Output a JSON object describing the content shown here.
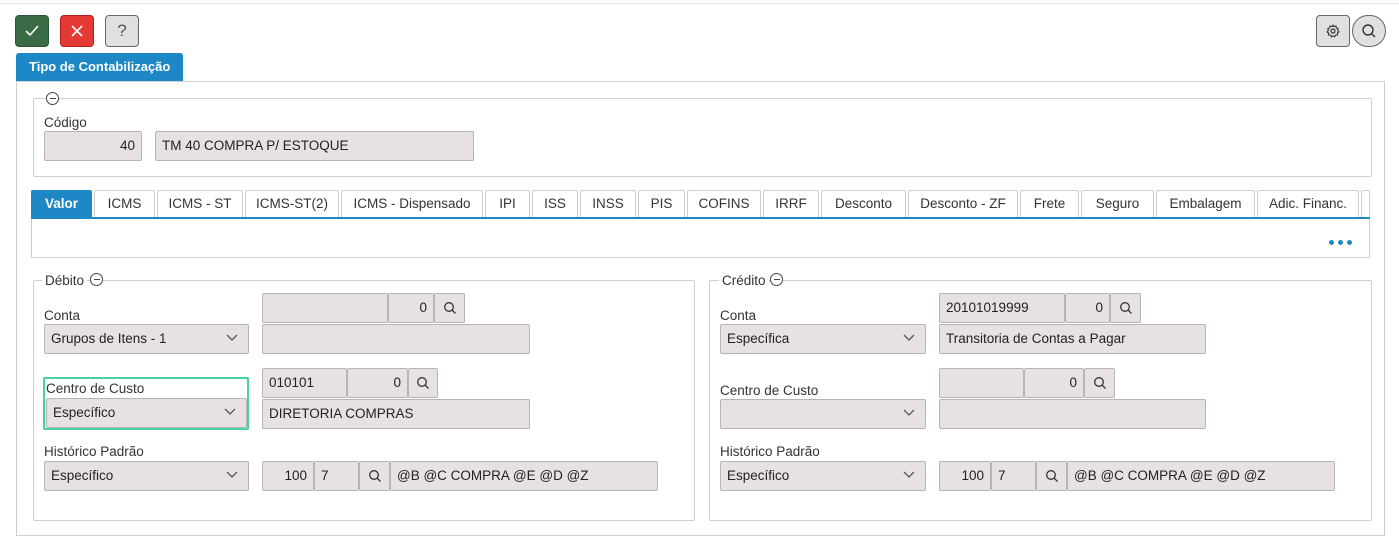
{
  "toolbar": {
    "confirm_icon": "check-icon",
    "cancel_icon": "close-icon",
    "help_label": "?",
    "gear_icon": "gear-icon",
    "search_icon": "search-icon"
  },
  "main_tab": {
    "label": "Tipo de Contabilização"
  },
  "header": {
    "codigo_label": "Código",
    "codigo_value": "40",
    "descricao_value": "TM 40 COMPRA P/ ESTOQUE"
  },
  "tabs": [
    {
      "label": "Valor",
      "active": true
    },
    {
      "label": "ICMS"
    },
    {
      "label": "ICMS - ST"
    },
    {
      "label": "ICMS-ST(2)"
    },
    {
      "label": "ICMS - Dispensado"
    },
    {
      "label": "IPI"
    },
    {
      "label": "ISS"
    },
    {
      "label": "INSS"
    },
    {
      "label": "PIS"
    },
    {
      "label": "COFINS"
    },
    {
      "label": "IRRF"
    },
    {
      "label": "Desconto"
    },
    {
      "label": "Desconto - ZF"
    },
    {
      "label": "Frete"
    },
    {
      "label": "Seguro"
    },
    {
      "label": "Embalagem"
    },
    {
      "label": "Adic. Financ."
    }
  ],
  "debito": {
    "title": "Débito",
    "conta_label": "Conta",
    "conta_code": "",
    "conta_num": "0",
    "conta_select": "Grupos de Itens - 1",
    "conta_desc": "",
    "cc_label": "Centro de Custo",
    "cc_code": "010101",
    "cc_num": "0",
    "cc_select": "Específico",
    "cc_desc": "DIRETORIA COMPRAS",
    "hist_label": "Histórico Padrão",
    "hist_select": "Específico",
    "hist_num1": "100",
    "hist_num2": "7",
    "hist_desc": "@B @C COMPRA @E @D @Z"
  },
  "credito": {
    "title": "Crédito",
    "conta_label": "Conta",
    "conta_code": "20101019999",
    "conta_num": "0",
    "conta_select": "Específica",
    "conta_desc": "Transitoria de Contas a Pagar",
    "cc_label": "Centro de Custo",
    "cc_code": "",
    "cc_num": "0",
    "cc_select": "",
    "cc_desc": "",
    "hist_label": "Histórico Padrão",
    "hist_select": "Específico",
    "hist_num1": "100",
    "hist_num2": "7",
    "hist_desc": "@B @C COMPRA @E @D @Z"
  },
  "colors": {
    "accent": "#1e88c7",
    "confirm": "#3a6b45",
    "cancel": "#e53935",
    "input_bg": "#e8e1e1",
    "focus": "#49d1a6"
  }
}
